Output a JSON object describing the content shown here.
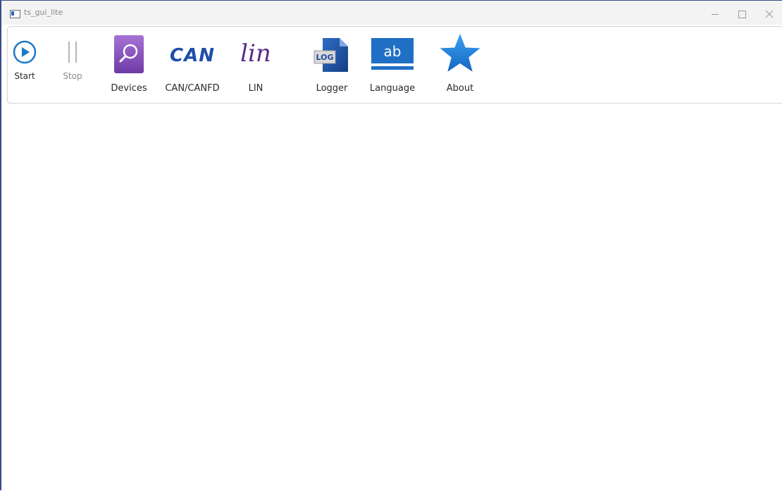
{
  "window": {
    "title": "ts_gui_lite",
    "controls": {
      "minimize": "minimize-icon",
      "maximize": "maximize-icon",
      "close": "close-icon"
    }
  },
  "toolbar": {
    "start_label": "Start",
    "stop_label": "Stop",
    "devices_label": "Devices",
    "can_label": "CAN/CANFD",
    "can_icon_text": "CAN",
    "lin_label": "LIN",
    "lin_icon_text": "lin",
    "logger_label": "Logger",
    "logger_icon_text": "LOG",
    "language_label": "Language",
    "language_icon_text": "ab",
    "about_label": "About"
  },
  "colors": {
    "start_blue": "#1e78c8",
    "devices_purple": "#8e4fc0",
    "can_blue": "#1f4fa8",
    "lin_purple": "#5b2a86",
    "logger_blue": "#1b4d9c",
    "language_blue": "#1f6fc5",
    "about_blue": "#1e7fd8"
  }
}
